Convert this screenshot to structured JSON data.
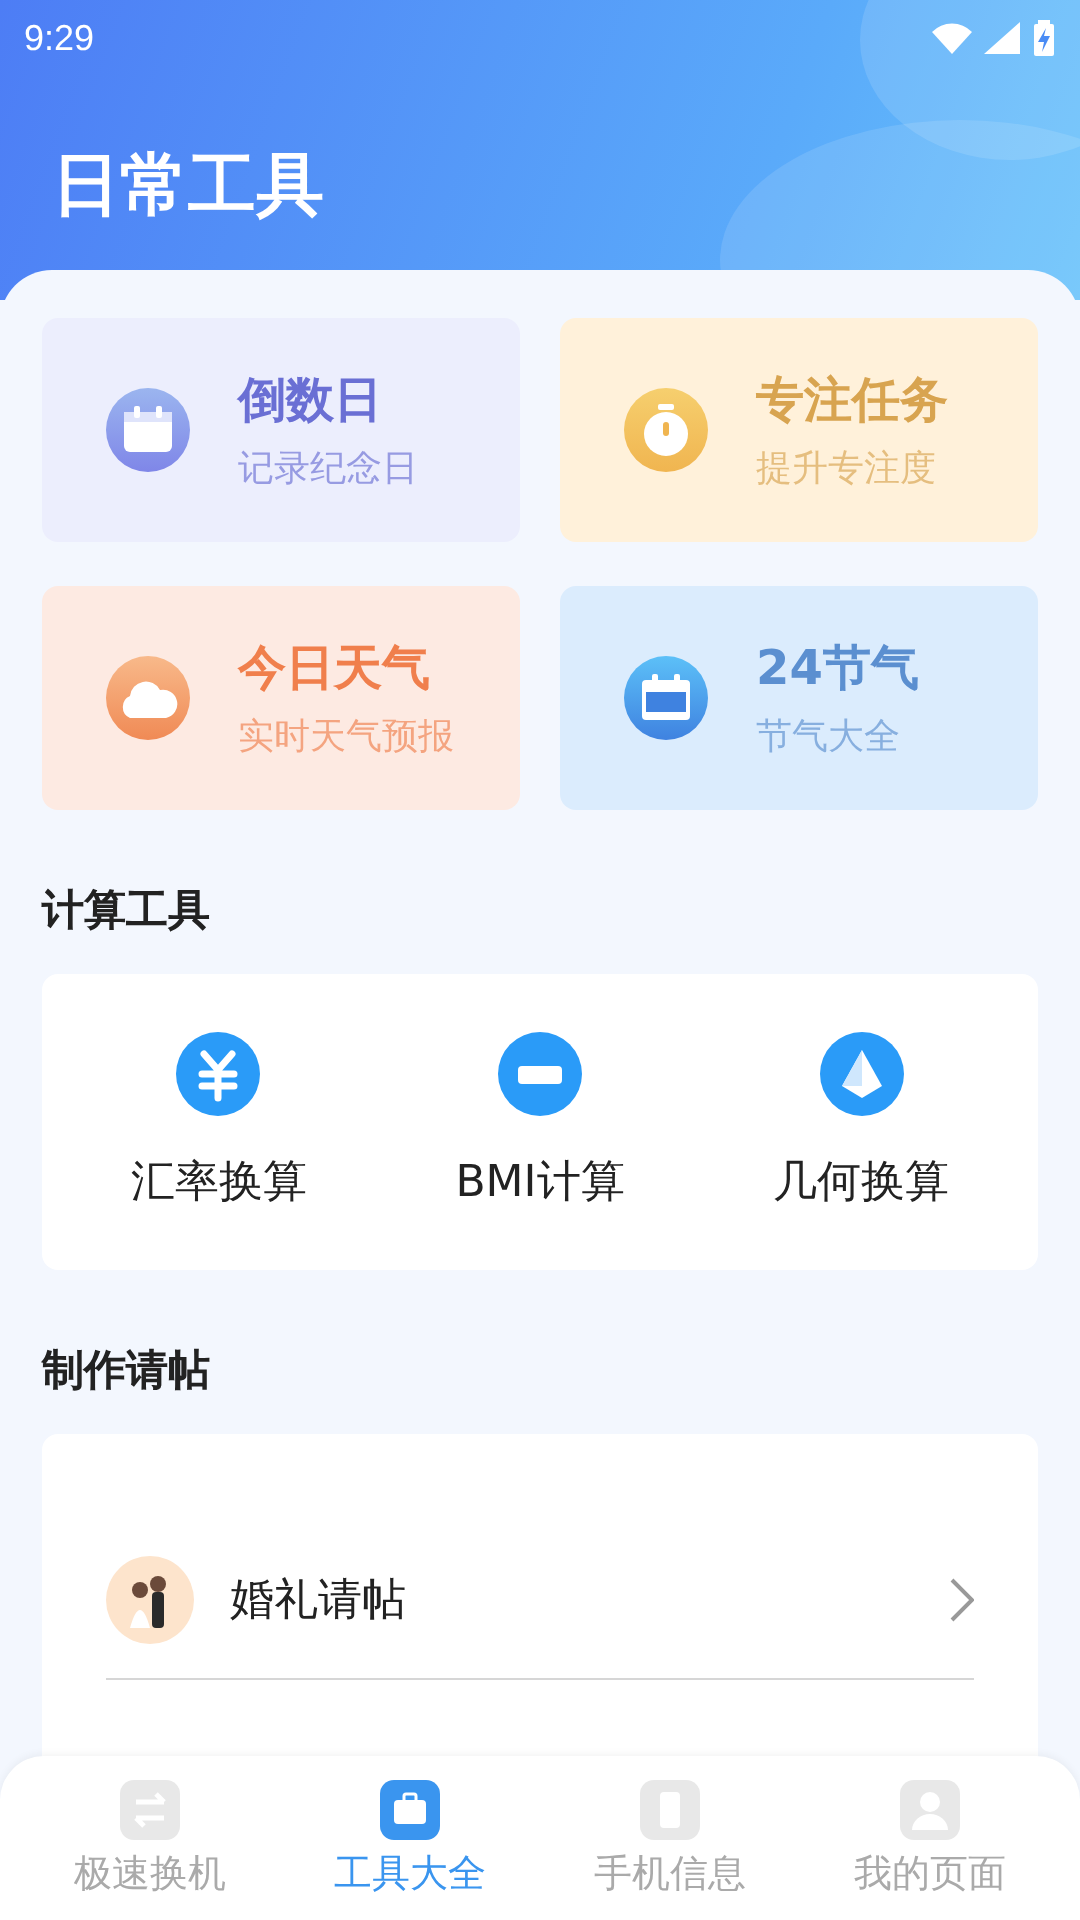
{
  "status_bar": {
    "time": "9:29"
  },
  "header": {
    "title": "日常工具"
  },
  "feature_cards": [
    {
      "kind": "calendar",
      "title": "倒数日",
      "subtitle": "记录纪念日",
      "color": "#6a6fd4"
    },
    {
      "kind": "timer",
      "title": "专注任务",
      "subtitle": "提升专注度",
      "color": "#d8a450"
    },
    {
      "kind": "weather",
      "title": "今日天气",
      "subtitle": "实时天气预报",
      "color": "#f07f4c"
    },
    {
      "kind": "solar_term",
      "title": "24节气",
      "subtitle": "节气大全",
      "color": "#5b8fd0"
    }
  ],
  "calc_section": {
    "title": "计算工具",
    "items": [
      {
        "kind": "currency",
        "label": "汇率换算"
      },
      {
        "kind": "bmi",
        "label": "BMI计算"
      },
      {
        "kind": "geometry",
        "label": "几何换算"
      }
    ]
  },
  "invite_section": {
    "title": "制作请帖",
    "items": [
      {
        "kind": "wedding",
        "label": "婚礼请帖"
      }
    ]
  },
  "bottom_nav": [
    {
      "kind": "swap",
      "label": "极速换机",
      "selected": false
    },
    {
      "kind": "toolbox",
      "label": "工具大全",
      "selected": true
    },
    {
      "kind": "phone",
      "label": "手机信息",
      "selected": false
    },
    {
      "kind": "user",
      "label": "我的页面",
      "selected": false
    }
  ]
}
